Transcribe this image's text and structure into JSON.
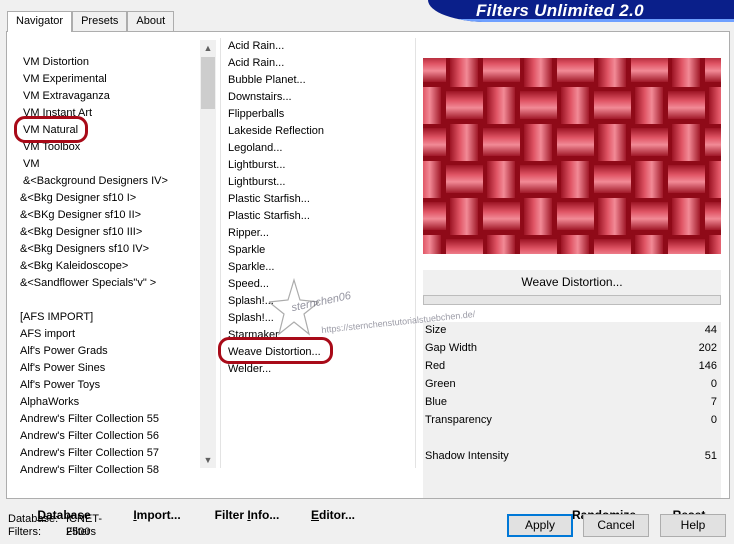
{
  "banner": {
    "title": "Filters Unlimited 2.0"
  },
  "tabs": [
    {
      "label": "Navigator",
      "active": true
    },
    {
      "label": "Presets",
      "active": false
    },
    {
      "label": "About",
      "active": false
    }
  ],
  "categories": [
    "VM Distortion",
    "VM Experimental",
    "VM Extravaganza",
    "VM Instant Art",
    "VM Natural",
    "VM Toolbox",
    "VM",
    "&<Background Designers IV>",
    "&<Bkg Designer sf10 I>",
    "&<BKg Designer sf10 II>",
    "&<Bkg Designer sf10 III>",
    "&<Bkg Designers sf10 IV>",
    "&<Bkg Kaleidoscope>",
    "&<Sandflower Specials\"v\" >",
    "",
    "[AFS IMPORT]",
    "AFS import",
    "Alf's Power Grads",
    "Alf's Power Sines",
    "Alf's Power Toys",
    "AlphaWorks",
    "Andrew's Filter Collection 55",
    "Andrew's Filter Collection 56",
    "Andrew's Filter Collection 57",
    "Andrew's Filter Collection 58"
  ],
  "filters": [
    "Acid Rain...",
    "Acid Rain...",
    "Bubble Planet...",
    "Downstairs...",
    "Flipperballs",
    "Lakeside Reflection",
    "Legoland...",
    "Lightburst...",
    "Lightburst...",
    "Plastic Starfish...",
    "Plastic Starfish...",
    "Ripper...",
    "Sparkle",
    "Sparkle...",
    "Speed...",
    "Splash!...",
    "Splash!...",
    "Starmaker",
    "Weave Distortion...",
    "Welder..."
  ],
  "selected_filter": "Weave Distortion...",
  "progress": 0,
  "params": [
    {
      "label": "Size",
      "value": "44"
    },
    {
      "label": "Gap Width",
      "value": "202"
    },
    {
      "label": "Red",
      "value": "146"
    },
    {
      "label": "Green",
      "value": "0"
    },
    {
      "label": "Blue",
      "value": "7"
    },
    {
      "label": "Transparency",
      "value": "0"
    },
    {
      "label": "Shadow Intensity",
      "value": "51"
    }
  ],
  "toolbar": {
    "database": {
      "u": "D",
      "rest": "atabase"
    },
    "import": {
      "u": "I",
      "rest": "mport..."
    },
    "filter_info": {
      "pre": "Filter ",
      "u": "I",
      "rest": "nfo..."
    },
    "editor": {
      "u": "E",
      "rest": "ditor..."
    },
    "randomize": "Randomize",
    "reset": "Reset"
  },
  "status": {
    "database_label": "Database:",
    "database_value": "ICNET-Filters",
    "filters_label": "Filters:",
    "filters_value": "2500"
  },
  "buttons": {
    "apply": "Apply",
    "cancel": "Cancel",
    "help": "Help"
  },
  "watermark": {
    "name": "sternchen06",
    "url": "https://sternchenstutorialstuebchen.de/"
  },
  "colors": {
    "highlight": "#a80a18",
    "banner": "#0a1f8a",
    "preview_bg": "#8f0a18",
    "weave": "#e05565"
  }
}
